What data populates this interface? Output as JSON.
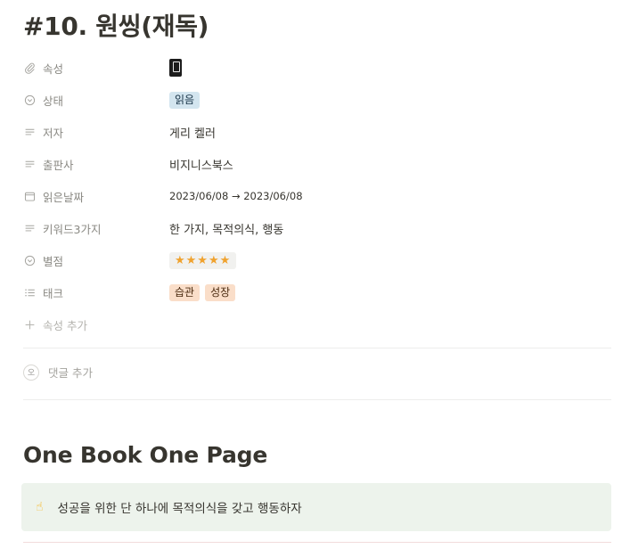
{
  "page": {
    "title": "#10. 원씽(재독)"
  },
  "properties": [
    {
      "label": "속성",
      "icon": "paperclip-icon",
      "kind": "icon",
      "value": ""
    },
    {
      "label": "상태",
      "icon": "status-circle-icon",
      "kind": "tags",
      "tags": [
        {
          "text": "읽음",
          "color": "blue"
        }
      ]
    },
    {
      "label": "저자",
      "icon": "text-lines-icon",
      "kind": "text",
      "value": "게리 켈러"
    },
    {
      "label": "출판사",
      "icon": "text-lines-icon",
      "kind": "text",
      "value": "비지니스북스"
    },
    {
      "label": "읽은날짜",
      "icon": "calendar-icon",
      "kind": "text-small",
      "value": "2023/06/08 → 2023/06/08"
    },
    {
      "label": "키워드3가지",
      "icon": "text-lines-icon",
      "kind": "text",
      "value": "한 가지, 목적의식, 행동"
    },
    {
      "label": "별점",
      "icon": "status-circle-icon",
      "kind": "tags",
      "tags": [
        {
          "text": "★★★★★",
          "color": "gray"
        }
      ]
    },
    {
      "label": "태크",
      "icon": "list-icon",
      "kind": "tags",
      "tags": [
        {
          "text": "습관",
          "color": "orange"
        },
        {
          "text": "성장",
          "color": "orange"
        }
      ]
    }
  ],
  "add_property_label": "속성 추가",
  "add_comment_label": "댓글 추가",
  "section_heading": "One Book One Page",
  "callout": {
    "emoji": "☝",
    "text": "성공을 위한 단 하나에 목적의식을 갖고 행동하자"
  }
}
